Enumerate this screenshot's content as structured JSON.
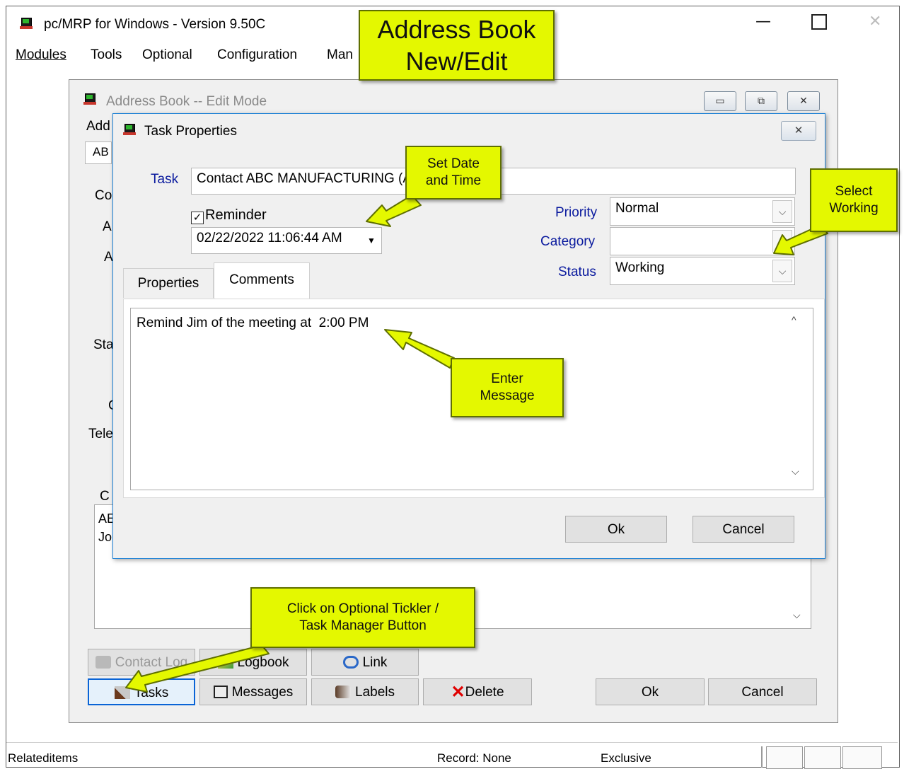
{
  "app": {
    "title": "pc/MRP for Windows - Version 9.50C",
    "menu": [
      "Modules",
      "Tools",
      "Optional",
      "Configuration",
      "Man"
    ]
  },
  "address_book": {
    "title": "Address Book -- Edit Mode",
    "fragments": {
      "add": "Add",
      "abc": "AB",
      "co": "Co",
      "a1": "A",
      "a2": "A",
      "sta": "Sta",
      "c": "C",
      "tele": "Tele",
      "c2": "C",
      "ae": "AE",
      "jo": "Jo"
    },
    "buttons": {
      "contact_log": "Contact Log",
      "logbook": "Logbook",
      "link": "Link",
      "tasks": "Tasks",
      "messages": "Messages",
      "labels": "Labels",
      "delete": "Delete",
      "ok": "Ok",
      "cancel": "Cancel"
    }
  },
  "task_dialog": {
    "title": "Task Properties",
    "task_label": "Task",
    "task_value": "Contact ABC MANUFACTURING (ABC001)",
    "reminder_label": "Reminder",
    "reminder_checked": true,
    "reminder_datetime": "02/22/2022 11:06:44 AM",
    "priority_label": "Priority",
    "priority_value": "Normal",
    "category_label": "Category",
    "category_value": "",
    "status_label": "Status",
    "status_value": "Working",
    "tabs": [
      "Properties",
      "Comments"
    ],
    "active_tab": "Comments",
    "comment": "Remind Jim of the meeting at  2:00 PM",
    "ok": "Ok",
    "cancel": "Cancel"
  },
  "callouts": {
    "title": [
      "Address Book",
      "New/Edit"
    ],
    "set_date": [
      "Set Date",
      "and Time"
    ],
    "select_working": [
      "Select",
      "Working"
    ],
    "enter_message": [
      "Enter",
      "Message"
    ],
    "tickler": [
      "Click on Optional Tickler /",
      "Task Manager Button"
    ]
  },
  "statusbar": {
    "left": "Relateditems",
    "record": "Record: None",
    "mode": "Exclusive"
  },
  "colors": {
    "callout": "#e4f800",
    "label_blue": "#0a1a9e",
    "dialog_border": "#1f82d5"
  }
}
